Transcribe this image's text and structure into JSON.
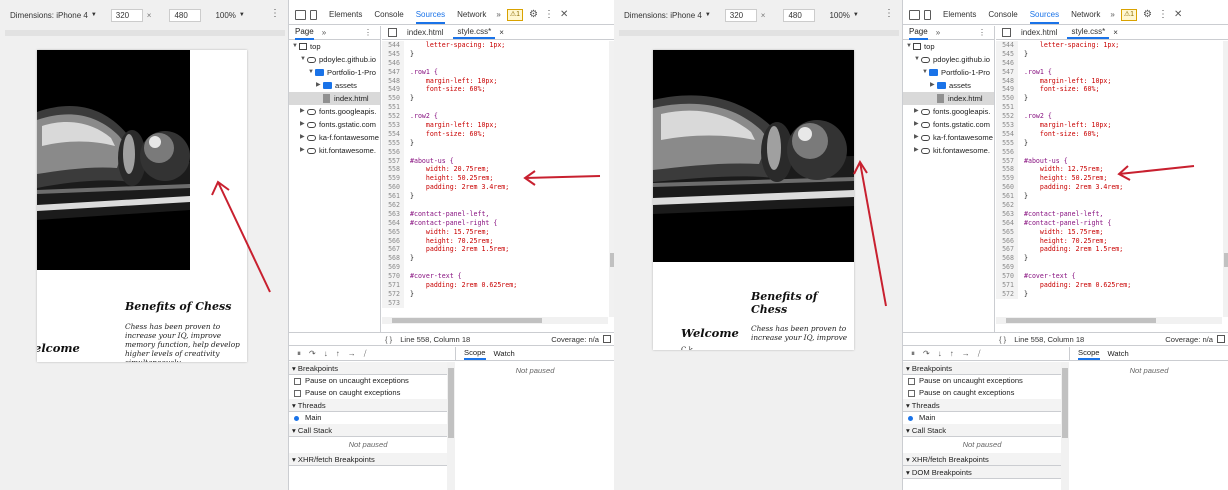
{
  "panels": [
    {
      "device": {
        "dimensions_label": "Dimensions: iPhone 4",
        "width_value": "320",
        "times": "×",
        "height_value": "480",
        "zoom_label": "100%"
      },
      "page": {
        "benefits_title": "Benefits of Chess",
        "benefits_text": "Chess has been proven to increase your IQ, improve memory function, help develop higher levels of creativity simultaneously",
        "welcome": "elcome",
        "welcome_sub": ""
      },
      "devtools": {
        "tabs": [
          "Elements",
          "Console",
          "Sources",
          "Network"
        ],
        "active_tab": "Sources",
        "more": "»",
        "warning_badge": "⚠1",
        "navigator": {
          "page_tab": "Page",
          "more": "»",
          "tree": [
            {
              "label": "top",
              "icon": "frame-icon",
              "indent": 0,
              "tri": "▼"
            },
            {
              "label": "pdoylec.github.io",
              "icon": "cloud-icon",
              "indent": 1,
              "tri": "▼"
            },
            {
              "label": "Portfolio-1-Pro",
              "icon": "folder-icon",
              "indent": 2,
              "tri": "▼"
            },
            {
              "label": "assets",
              "icon": "folder-icon",
              "indent": 3,
              "tri": "▶"
            },
            {
              "label": "index.html",
              "icon": "file-icon",
              "indent": 3,
              "tri": "",
              "selected": true
            },
            {
              "label": "fonts.googleapis.",
              "icon": "cloud-icon",
              "indent": 1,
              "tri": "▶"
            },
            {
              "label": "fonts.gstatic.com",
              "icon": "cloud-icon",
              "indent": 1,
              "tri": "▶"
            },
            {
              "label": "ka-f.fontawesome",
              "icon": "cloud-icon",
              "indent": 1,
              "tri": "▶"
            },
            {
              "label": "kit.fontawesome.",
              "icon": "cloud-icon",
              "indent": 1,
              "tri": "▶"
            }
          ]
        },
        "editor": {
          "file_tabs": [
            "index.html",
            "style.css*"
          ],
          "active_file": "style.css*",
          "close_glyph": "×",
          "lines": [
            {
              "n": "544",
              "t": "    letter-spacing: 1px;",
              "k": "prop"
            },
            {
              "n": "545",
              "t": "}",
              "k": "brace"
            },
            {
              "n": "546",
              "t": "",
              "k": "brace"
            },
            {
              "n": "547",
              "t": ".row1 {",
              "k": "sel"
            },
            {
              "n": "548",
              "t": "    margin-left: 10px;",
              "k": "prop"
            },
            {
              "n": "549",
              "t": "    font-size: 60%;",
              "k": "prop"
            },
            {
              "n": "550",
              "t": "}",
              "k": "brace"
            },
            {
              "n": "551",
              "t": "",
              "k": "brace"
            },
            {
              "n": "552",
              "t": ".row2 {",
              "k": "sel"
            },
            {
              "n": "553",
              "t": "    margin-left: 10px;",
              "k": "prop"
            },
            {
              "n": "554",
              "t": "    font-size: 60%;",
              "k": "prop"
            },
            {
              "n": "555",
              "t": "}",
              "k": "brace"
            },
            {
              "n": "556",
              "t": "",
              "k": "brace"
            },
            {
              "n": "557",
              "t": "#about-us {",
              "k": "sel"
            },
            {
              "n": "558",
              "t": "    width: 20.75rem;",
              "k": "prop"
            },
            {
              "n": "559",
              "t": "    height: 50.25rem;",
              "k": "prop"
            },
            {
              "n": "560",
              "t": "    padding: 2rem 3.4rem;",
              "k": "prop"
            },
            {
              "n": "561",
              "t": "}",
              "k": "brace"
            },
            {
              "n": "562",
              "t": "",
              "k": "brace"
            },
            {
              "n": "563",
              "t": "#contact-panel-left,",
              "k": "sel"
            },
            {
              "n": "564",
              "t": "#contact-panel-right {",
              "k": "sel"
            },
            {
              "n": "565",
              "t": "    width: 15.75rem;",
              "k": "prop"
            },
            {
              "n": "566",
              "t": "    height: 70.25rem;",
              "k": "prop"
            },
            {
              "n": "567",
              "t": "    padding: 2rem 1.5rem;",
              "k": "prop"
            },
            {
              "n": "568",
              "t": "}",
              "k": "brace"
            },
            {
              "n": "569",
              "t": "",
              "k": "brace"
            },
            {
              "n": "570",
              "t": "#cover-text {",
              "k": "sel"
            },
            {
              "n": "571",
              "t": "    padding: 2rem 0.625rem;",
              "k": "prop"
            },
            {
              "n": "572",
              "t": "}",
              "k": "brace"
            },
            {
              "n": "573",
              "t": "",
              "k": "brace"
            }
          ]
        },
        "status": {
          "braces": "{ }",
          "position": "Line 558, Column 18",
          "coverage": "Coverage: n/a"
        },
        "scope_tabs": [
          "Scope",
          "Watch"
        ],
        "not_paused": "Not paused",
        "debug": {
          "sections": [
            {
              "title": "Breakpoints",
              "rows": [
                {
                  "type": "check",
                  "label": "Pause on uncaught exceptions"
                },
                {
                  "type": "check",
                  "label": "Pause on caught exceptions"
                }
              ]
            },
            {
              "title": "Threads",
              "rows": [
                {
                  "type": "dot",
                  "label": "Main"
                }
              ]
            },
            {
              "title": "Call Stack",
              "rows": [
                {
                  "type": "center",
                  "label": "Not paused"
                }
              ]
            },
            {
              "title": "XHR/fetch Breakpoints",
              "rows": []
            }
          ]
        }
      }
    },
    {
      "device": {
        "dimensions_label": "Dimensions: iPhone 4",
        "width_value": "320",
        "times": "×",
        "height_value": "480",
        "zoom_label": "100%"
      },
      "page": {
        "benefits_title": "Benefits of Chess",
        "benefits_text": "Chess has been proven to increase your IQ, improve",
        "welcome": "Welcome",
        "welcome_sub": "C  k"
      },
      "devtools": {
        "tabs": [
          "Elements",
          "Console",
          "Sources",
          "Network"
        ],
        "active_tab": "Sources",
        "more": "»",
        "warning_badge": "⚠1",
        "navigator": {
          "page_tab": "Page",
          "more": "»",
          "tree": [
            {
              "label": "top",
              "icon": "frame-icon",
              "indent": 0,
              "tri": "▼"
            },
            {
              "label": "pdoylec.github.io",
              "icon": "cloud-icon",
              "indent": 1,
              "tri": "▼"
            },
            {
              "label": "Portfolio-1-Pro",
              "icon": "folder-icon",
              "indent": 2,
              "tri": "▼"
            },
            {
              "label": "assets",
              "icon": "folder-icon",
              "indent": 3,
              "tri": "▶"
            },
            {
              "label": "index.html",
              "icon": "file-icon",
              "indent": 3,
              "tri": "",
              "selected": true
            },
            {
              "label": "fonts.googleapis.",
              "icon": "cloud-icon",
              "indent": 1,
              "tri": "▶"
            },
            {
              "label": "fonts.gstatic.com",
              "icon": "cloud-icon",
              "indent": 1,
              "tri": "▶"
            },
            {
              "label": "ka-f.fontawesome",
              "icon": "cloud-icon",
              "indent": 1,
              "tri": "▶"
            },
            {
              "label": "kit.fontawesome.",
              "icon": "cloud-icon",
              "indent": 1,
              "tri": "▶"
            }
          ]
        },
        "editor": {
          "file_tabs": [
            "index.html",
            "style.css*"
          ],
          "active_file": "style.css*",
          "close_glyph": "×",
          "lines": [
            {
              "n": "544",
              "t": "    letter-spacing: 1px;",
              "k": "prop"
            },
            {
              "n": "545",
              "t": "}",
              "k": "brace"
            },
            {
              "n": "546",
              "t": "",
              "k": "brace"
            },
            {
              "n": "547",
              "t": ".row1 {",
              "k": "sel"
            },
            {
              "n": "548",
              "t": "    margin-left: 10px;",
              "k": "prop"
            },
            {
              "n": "549",
              "t": "    font-size: 60%;",
              "k": "prop"
            },
            {
              "n": "550",
              "t": "}",
              "k": "brace"
            },
            {
              "n": "551",
              "t": "",
              "k": "brace"
            },
            {
              "n": "552",
              "t": ".row2 {",
              "k": "sel"
            },
            {
              "n": "553",
              "t": "    margin-left: 10px;",
              "k": "prop"
            },
            {
              "n": "554",
              "t": "    font-size: 60%;",
              "k": "prop"
            },
            {
              "n": "555",
              "t": "}",
              "k": "brace"
            },
            {
              "n": "556",
              "t": "",
              "k": "brace"
            },
            {
              "n": "557",
              "t": "#about-us {",
              "k": "sel"
            },
            {
              "n": "558",
              "t": "    width: 12.75rem;",
              "k": "prop"
            },
            {
              "n": "559",
              "t": "    height: 50.25rem;",
              "k": "prop"
            },
            {
              "n": "560",
              "t": "    padding: 2rem 3.4rem;",
              "k": "prop"
            },
            {
              "n": "561",
              "t": "}",
              "k": "brace"
            },
            {
              "n": "562",
              "t": "",
              "k": "brace"
            },
            {
              "n": "563",
              "t": "#contact-panel-left,",
              "k": "sel"
            },
            {
              "n": "564",
              "t": "#contact-panel-right {",
              "k": "sel"
            },
            {
              "n": "565",
              "t": "    width: 15.75rem;",
              "k": "prop"
            },
            {
              "n": "566",
              "t": "    height: 70.25rem;",
              "k": "prop"
            },
            {
              "n": "567",
              "t": "    padding: 2rem 1.5rem;",
              "k": "prop"
            },
            {
              "n": "568",
              "t": "}",
              "k": "brace"
            },
            {
              "n": "569",
              "t": "",
              "k": "brace"
            },
            {
              "n": "570",
              "t": "#cover-text {",
              "k": "sel"
            },
            {
              "n": "571",
              "t": "    padding: 2rem 0.625rem;",
              "k": "prop"
            },
            {
              "n": "572",
              "t": "}",
              "k": "brace"
            }
          ]
        },
        "status": {
          "braces": "{ }",
          "position": "Line 558, Column 18",
          "coverage": "Coverage: n/a"
        },
        "scope_tabs": [
          "Scope",
          "Watch"
        ],
        "not_paused": "Not paused",
        "debug": {
          "sections": [
            {
              "title": "Breakpoints",
              "rows": [
                {
                  "type": "check",
                  "label": "Pause on uncaught exceptions"
                },
                {
                  "type": "check",
                  "label": "Pause on caught exceptions"
                }
              ]
            },
            {
              "title": "Threads",
              "rows": [
                {
                  "type": "dot",
                  "label": "Main"
                }
              ]
            },
            {
              "title": "Call Stack",
              "rows": [
                {
                  "type": "center",
                  "label": "Not paused"
                }
              ]
            },
            {
              "title": "XHR/fetch Breakpoints",
              "rows": []
            },
            {
              "title": "DOM Breakpoints",
              "rows": []
            }
          ]
        }
      }
    }
  ],
  "colors": {
    "annotation_arrow": "#c8202f",
    "accent": "#1a73e8",
    "selector": "#881280",
    "property": "#c80000"
  }
}
